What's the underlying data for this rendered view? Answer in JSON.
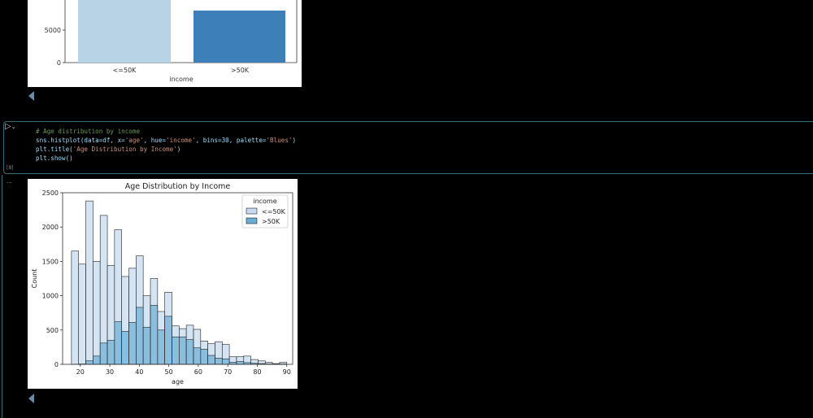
{
  "top_chart": {
    "xlabel": "income",
    "categories": [
      "<=50K",
      ">50K"
    ],
    "y_ticks": [
      "5000",
      "0"
    ],
    "colors": [
      "#b8d3e6",
      "#3d7fb9"
    ]
  },
  "cell": {
    "run_icon": "play-icon",
    "execution_count": "[8]",
    "output_indicator": "...",
    "code": {
      "comment": "# Age distribution by income",
      "line2_a": "sns.histplot(data=df, x=",
      "line2_s1": "'age'",
      "line2_b": ", hue=",
      "line2_s2": "'income'",
      "line2_c": ", bins=30, palette=",
      "line2_s3": "'Blues'",
      "line2_d": ")",
      "line3_a": "plt.title(",
      "line3_s": "'Age Distribution by Income'",
      "line3_b": ")",
      "line4": "plt.show()"
    }
  },
  "chart_data": {
    "type": "bar",
    "title": "Age Distribution by Income",
    "xlabel": "age",
    "ylabel": "Count",
    "xlim": [
      14,
      92
    ],
    "ylim": [
      0,
      2500
    ],
    "x_ticks": [
      20,
      30,
      40,
      50,
      60,
      70,
      80,
      90
    ],
    "y_ticks": [
      0,
      500,
      1000,
      1500,
      2000,
      2500
    ],
    "legend_title": "income",
    "legend_position": "top-right",
    "bin_edges": [
      17,
      19.43,
      21.87,
      24.3,
      26.73,
      29.17,
      31.6,
      34.03,
      36.47,
      38.9,
      41.33,
      43.77,
      46.2,
      48.63,
      51.07,
      53.5,
      55.93,
      58.37,
      60.8,
      63.23,
      65.67,
      68.1,
      70.53,
      72.97,
      75.4,
      77.83,
      80.27,
      82.7,
      85.13,
      87.57,
      90
    ],
    "series": [
      {
        "name": "<=50K",
        "color": "#c6dbef",
        "values": [
          1650,
          1460,
          2380,
          1500,
          2170,
          1440,
          1960,
          1280,
          1400,
          1580,
          1000,
          1250,
          770,
          1050,
          560,
          520,
          570,
          510,
          340,
          300,
          330,
          290,
          110,
          110,
          120,
          70,
          50,
          30,
          10,
          30
        ]
      },
      {
        "name": ">50K",
        "color": "#6aaed6",
        "values": [
          0,
          5,
          50,
          120,
          310,
          350,
          620,
          480,
          610,
          830,
          540,
          860,
          500,
          700,
          400,
          400,
          360,
          240,
          220,
          130,
          90,
          80,
          30,
          40,
          25,
          15,
          10,
          5,
          5,
          5
        ]
      }
    ]
  }
}
